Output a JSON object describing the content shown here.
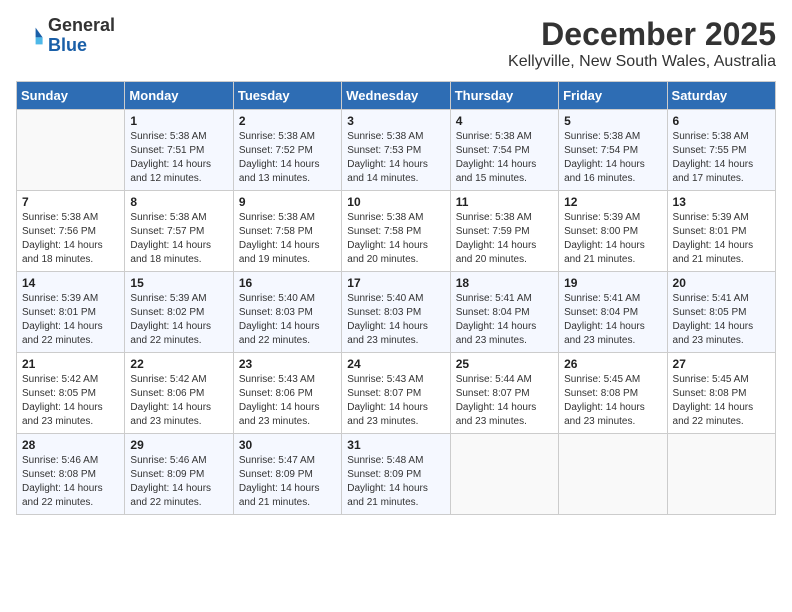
{
  "logo": {
    "general": "General",
    "blue": "Blue"
  },
  "header": {
    "month": "December 2025",
    "location": "Kellyville, New South Wales, Australia"
  },
  "days_of_week": [
    "Sunday",
    "Monday",
    "Tuesday",
    "Wednesday",
    "Thursday",
    "Friday",
    "Saturday"
  ],
  "weeks": [
    [
      {
        "day": "",
        "content": ""
      },
      {
        "day": "1",
        "content": "Sunrise: 5:38 AM\nSunset: 7:51 PM\nDaylight: 14 hours\nand 12 minutes."
      },
      {
        "day": "2",
        "content": "Sunrise: 5:38 AM\nSunset: 7:52 PM\nDaylight: 14 hours\nand 13 minutes."
      },
      {
        "day": "3",
        "content": "Sunrise: 5:38 AM\nSunset: 7:53 PM\nDaylight: 14 hours\nand 14 minutes."
      },
      {
        "day": "4",
        "content": "Sunrise: 5:38 AM\nSunset: 7:54 PM\nDaylight: 14 hours\nand 15 minutes."
      },
      {
        "day": "5",
        "content": "Sunrise: 5:38 AM\nSunset: 7:54 PM\nDaylight: 14 hours\nand 16 minutes."
      },
      {
        "day": "6",
        "content": "Sunrise: 5:38 AM\nSunset: 7:55 PM\nDaylight: 14 hours\nand 17 minutes."
      }
    ],
    [
      {
        "day": "7",
        "content": "Sunrise: 5:38 AM\nSunset: 7:56 PM\nDaylight: 14 hours\nand 18 minutes."
      },
      {
        "day": "8",
        "content": "Sunrise: 5:38 AM\nSunset: 7:57 PM\nDaylight: 14 hours\nand 18 minutes."
      },
      {
        "day": "9",
        "content": "Sunrise: 5:38 AM\nSunset: 7:58 PM\nDaylight: 14 hours\nand 19 minutes."
      },
      {
        "day": "10",
        "content": "Sunrise: 5:38 AM\nSunset: 7:58 PM\nDaylight: 14 hours\nand 20 minutes."
      },
      {
        "day": "11",
        "content": "Sunrise: 5:38 AM\nSunset: 7:59 PM\nDaylight: 14 hours\nand 20 minutes."
      },
      {
        "day": "12",
        "content": "Sunrise: 5:39 AM\nSunset: 8:00 PM\nDaylight: 14 hours\nand 21 minutes."
      },
      {
        "day": "13",
        "content": "Sunrise: 5:39 AM\nSunset: 8:01 PM\nDaylight: 14 hours\nand 21 minutes."
      }
    ],
    [
      {
        "day": "14",
        "content": "Sunrise: 5:39 AM\nSunset: 8:01 PM\nDaylight: 14 hours\nand 22 minutes."
      },
      {
        "day": "15",
        "content": "Sunrise: 5:39 AM\nSunset: 8:02 PM\nDaylight: 14 hours\nand 22 minutes."
      },
      {
        "day": "16",
        "content": "Sunrise: 5:40 AM\nSunset: 8:03 PM\nDaylight: 14 hours\nand 22 minutes."
      },
      {
        "day": "17",
        "content": "Sunrise: 5:40 AM\nSunset: 8:03 PM\nDaylight: 14 hours\nand 23 minutes."
      },
      {
        "day": "18",
        "content": "Sunrise: 5:41 AM\nSunset: 8:04 PM\nDaylight: 14 hours\nand 23 minutes."
      },
      {
        "day": "19",
        "content": "Sunrise: 5:41 AM\nSunset: 8:04 PM\nDaylight: 14 hours\nand 23 minutes."
      },
      {
        "day": "20",
        "content": "Sunrise: 5:41 AM\nSunset: 8:05 PM\nDaylight: 14 hours\nand 23 minutes."
      }
    ],
    [
      {
        "day": "21",
        "content": "Sunrise: 5:42 AM\nSunset: 8:05 PM\nDaylight: 14 hours\nand 23 minutes."
      },
      {
        "day": "22",
        "content": "Sunrise: 5:42 AM\nSunset: 8:06 PM\nDaylight: 14 hours\nand 23 minutes."
      },
      {
        "day": "23",
        "content": "Sunrise: 5:43 AM\nSunset: 8:06 PM\nDaylight: 14 hours\nand 23 minutes."
      },
      {
        "day": "24",
        "content": "Sunrise: 5:43 AM\nSunset: 8:07 PM\nDaylight: 14 hours\nand 23 minutes."
      },
      {
        "day": "25",
        "content": "Sunrise: 5:44 AM\nSunset: 8:07 PM\nDaylight: 14 hours\nand 23 minutes."
      },
      {
        "day": "26",
        "content": "Sunrise: 5:45 AM\nSunset: 8:08 PM\nDaylight: 14 hours\nand 23 minutes."
      },
      {
        "day": "27",
        "content": "Sunrise: 5:45 AM\nSunset: 8:08 PM\nDaylight: 14 hours\nand 22 minutes."
      }
    ],
    [
      {
        "day": "28",
        "content": "Sunrise: 5:46 AM\nSunset: 8:08 PM\nDaylight: 14 hours\nand 22 minutes."
      },
      {
        "day": "29",
        "content": "Sunrise: 5:46 AM\nSunset: 8:09 PM\nDaylight: 14 hours\nand 22 minutes."
      },
      {
        "day": "30",
        "content": "Sunrise: 5:47 AM\nSunset: 8:09 PM\nDaylight: 14 hours\nand 21 minutes."
      },
      {
        "day": "31",
        "content": "Sunrise: 5:48 AM\nSunset: 8:09 PM\nDaylight: 14 hours\nand 21 minutes."
      },
      {
        "day": "",
        "content": ""
      },
      {
        "day": "",
        "content": ""
      },
      {
        "day": "",
        "content": ""
      }
    ]
  ]
}
